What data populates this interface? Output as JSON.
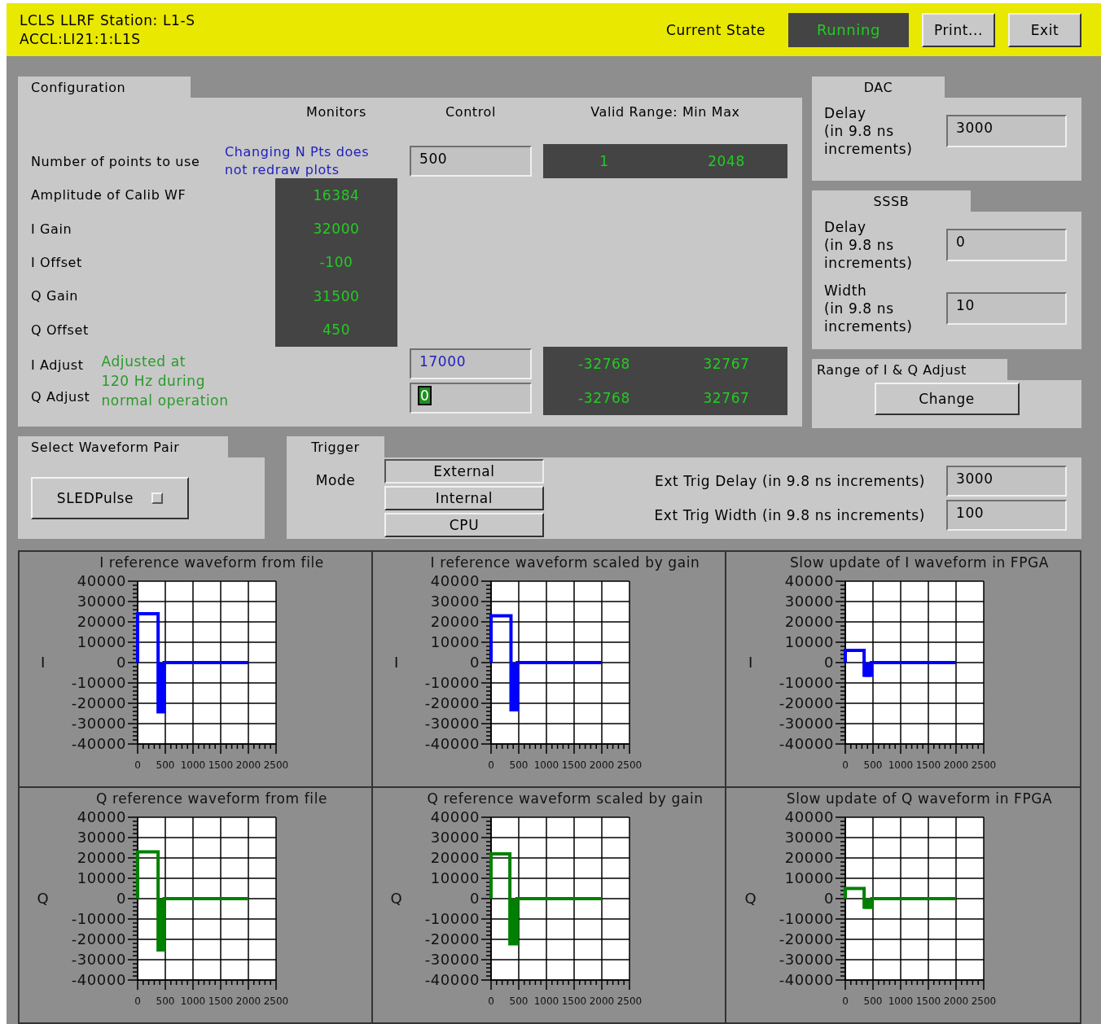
{
  "header": {
    "title_lines": [
      "LCLS LLRF Station: L1-S",
      "ACCL:LI21:1:L1S"
    ],
    "state_label": "Current State",
    "state_value": "Running",
    "buttons": [
      {
        "label": "Print..."
      },
      {
        "label": "Exit"
      }
    ]
  },
  "configuration": {
    "title": "Configuration",
    "columns": [
      "Monitors",
      "Control",
      "Valid Range: Min Max"
    ],
    "npts": {
      "label": "Number of points to use",
      "note_lines": [
        "Changing N Pts does",
        "not redraw plots"
      ],
      "control": "500",
      "min": "1",
      "max": "2048"
    },
    "monitors": [
      {
        "label": "Amplitude of Calib WF",
        "value": "16384"
      },
      {
        "label": "I Gain",
        "value": "32000"
      },
      {
        "label": "I Offset",
        "value": "-100"
      },
      {
        "label": "Q Gain",
        "value": "31500"
      },
      {
        "label": "Q Offset",
        "value": "450"
      }
    ],
    "adjust": {
      "note_lines": [
        "Adjusted at",
        "120 Hz during",
        "normal operation"
      ],
      "rows": [
        {
          "label": "I Adjust",
          "control": "17000",
          "min": "-32768",
          "max": "32767",
          "focused": false
        },
        {
          "label": "Q Adjust",
          "control": "0",
          "min": "-32768",
          "max": "32767",
          "focused": true
        }
      ]
    }
  },
  "dac": {
    "title": "DAC",
    "fields": [
      {
        "label_lines": [
          "Delay",
          "(in 9.8 ns",
          "increments)"
        ],
        "value": "3000"
      }
    ]
  },
  "sssb": {
    "title": "SSSB",
    "fields": [
      {
        "label_lines": [
          "Delay",
          "(in 9.8 ns",
          "increments)"
        ],
        "value": "0"
      },
      {
        "label_lines": [
          "Width",
          "(in 9.8 ns",
          "increments)"
        ],
        "value": "10"
      }
    ]
  },
  "iq_range": {
    "title": "Range of I & Q Adjust",
    "button": "Change"
  },
  "waveform_pair": {
    "title": "Select Waveform Pair",
    "menu": "SLEDPulse"
  },
  "trigger": {
    "title": "Trigger",
    "mode_label": "Mode",
    "modes": [
      {
        "label": "External",
        "selected": true
      },
      {
        "label": "Internal",
        "selected": false
      },
      {
        "label": "CPU",
        "selected": false
      }
    ],
    "fields": [
      {
        "label": "Ext Trig Delay (in 9.8 ns increments)",
        "value": "3000"
      },
      {
        "label": "Ext Trig Width (in 9.8 ns increments)",
        "value": "100"
      }
    ]
  },
  "plots": [
    {
      "chart_data": {
        "type": "line",
        "title": "I reference waveform from file",
        "ylabel": "I",
        "xlim": [
          0,
          2500
        ],
        "ylim": [
          -40000,
          40000
        ],
        "xticks": [
          0,
          500,
          1000,
          1500,
          2000,
          2500
        ],
        "yticks": [
          -40000,
          -30000,
          -20000,
          -10000,
          0,
          10000,
          20000,
          30000,
          40000
        ],
        "grid": true,
        "x": [
          0,
          0,
          370,
          370,
          390,
          410,
          430,
          450,
          470,
          480,
          480,
          2000
        ],
        "series": [
          {
            "color": "#0000ff",
            "values": [
              0,
              24000,
              24000,
              -25000,
              0,
              -25000,
              0,
              -25000,
              0,
              -25000,
              0,
              0
            ]
          }
        ]
      }
    },
    {
      "chart_data": {
        "type": "line",
        "title": "I reference waveform scaled by gain",
        "ylabel": "I",
        "xlim": [
          0,
          2500
        ],
        "ylim": [
          -40000,
          40000
        ],
        "xticks": [
          0,
          500,
          1000,
          1500,
          2000,
          2500
        ],
        "yticks": [
          -40000,
          -30000,
          -20000,
          -10000,
          0,
          10000,
          20000,
          30000,
          40000
        ],
        "grid": true,
        "x": [
          0,
          0,
          360,
          360,
          380,
          400,
          420,
          440,
          460,
          475,
          475,
          2000
        ],
        "series": [
          {
            "color": "#0000ff",
            "values": [
              0,
              23000,
              23000,
              -24000,
              0,
              -24000,
              0,
              -24000,
              0,
              -24000,
              0,
              0
            ]
          }
        ]
      }
    },
    {
      "chart_data": {
        "type": "line",
        "title": "Slow update of I waveform in FPGA",
        "ylabel": "I",
        "xlim": [
          0,
          2500
        ],
        "ylim": [
          -40000,
          40000
        ],
        "xticks": [
          0,
          500,
          1000,
          1500,
          2000,
          2500
        ],
        "yticks": [
          -40000,
          -30000,
          -20000,
          -10000,
          0,
          10000,
          20000,
          30000,
          40000
        ],
        "grid": true,
        "x": [
          0,
          0,
          340,
          340,
          365,
          390,
          415,
          440,
          465,
          470,
          470,
          2000
        ],
        "series": [
          {
            "color": "#0000ff",
            "values": [
              0,
              6000,
              6000,
              -7000,
              0,
              -7000,
              0,
              -7000,
              0,
              -7000,
              0,
              0
            ]
          }
        ]
      }
    },
    {
      "chart_data": {
        "type": "line",
        "title": "Q reference waveform from file",
        "ylabel": "Q",
        "xlim": [
          0,
          2500
        ],
        "ylim": [
          -40000,
          40000
        ],
        "xticks": [
          0,
          500,
          1000,
          1500,
          2000,
          2500
        ],
        "yticks": [
          -40000,
          -30000,
          -20000,
          -10000,
          0,
          10000,
          20000,
          30000,
          40000
        ],
        "grid": true,
        "x": [
          0,
          0,
          370,
          370,
          390,
          410,
          430,
          450,
          470,
          480,
          480,
          2000
        ],
        "series": [
          {
            "color": "#008000",
            "values": [
              0,
              23000,
              23000,
              -26000,
              0,
              -26000,
              0,
              -26000,
              0,
              -26000,
              0,
              0
            ]
          }
        ]
      }
    },
    {
      "chart_data": {
        "type": "line",
        "title": "Q reference waveform scaled by gain",
        "ylabel": "Q",
        "xlim": [
          0,
          2500
        ],
        "ylim": [
          -40000,
          40000
        ],
        "xticks": [
          0,
          500,
          1000,
          1500,
          2000,
          2500
        ],
        "yticks": [
          -40000,
          -30000,
          -20000,
          -10000,
          0,
          10000,
          20000,
          30000,
          40000
        ],
        "grid": true,
        "x": [
          0,
          0,
          340,
          340,
          365,
          390,
          415,
          440,
          465,
          470,
          470,
          2000
        ],
        "series": [
          {
            "color": "#008000",
            "values": [
              0,
              22000,
              22000,
              -23000,
              0,
              -23000,
              0,
              -23000,
              0,
              -23000,
              0,
              0
            ]
          }
        ]
      }
    },
    {
      "chart_data": {
        "type": "line",
        "title": "Slow update of Q waveform in FPGA",
        "ylabel": "Q",
        "xlim": [
          0,
          2500
        ],
        "ylim": [
          -40000,
          40000
        ],
        "xticks": [
          0,
          500,
          1000,
          1500,
          2000,
          2500
        ],
        "yticks": [
          -40000,
          -30000,
          -20000,
          -10000,
          0,
          10000,
          20000,
          30000,
          40000
        ],
        "grid": true,
        "x": [
          0,
          0,
          340,
          340,
          365,
          390,
          415,
          440,
          465,
          480,
          480,
          2000
        ],
        "series": [
          {
            "color": "#008000",
            "values": [
              0,
              5000,
              5000,
              -5000,
              0,
              -5000,
              0,
              -5000,
              0,
              -5000,
              0,
              0
            ]
          }
        ]
      }
    }
  ]
}
